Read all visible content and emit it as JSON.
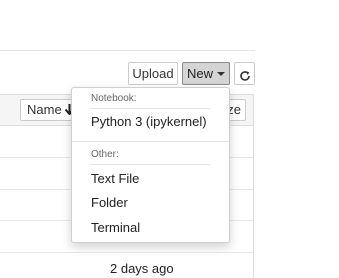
{
  "toolbar": {
    "upload_label": "Upload",
    "new_label": "New",
    "refresh_icon": "refresh-icon"
  },
  "file_list": {
    "sort_name_label": "Name",
    "sort_name_icon": "arrow-down-icon",
    "sort_size_label": "ze",
    "rows": [
      {
        "modified": ""
      },
      {
        "modified": ""
      },
      {
        "modified": ""
      },
      {
        "modified": ""
      },
      {
        "modified": "2 days ago"
      }
    ]
  },
  "new_menu": {
    "notebook_header": "Notebook:",
    "notebook_items": [
      "Python 3 (ipykernel)"
    ],
    "other_header": "Other:",
    "other_items": [
      "Text File",
      "Folder",
      "Terminal"
    ]
  }
}
